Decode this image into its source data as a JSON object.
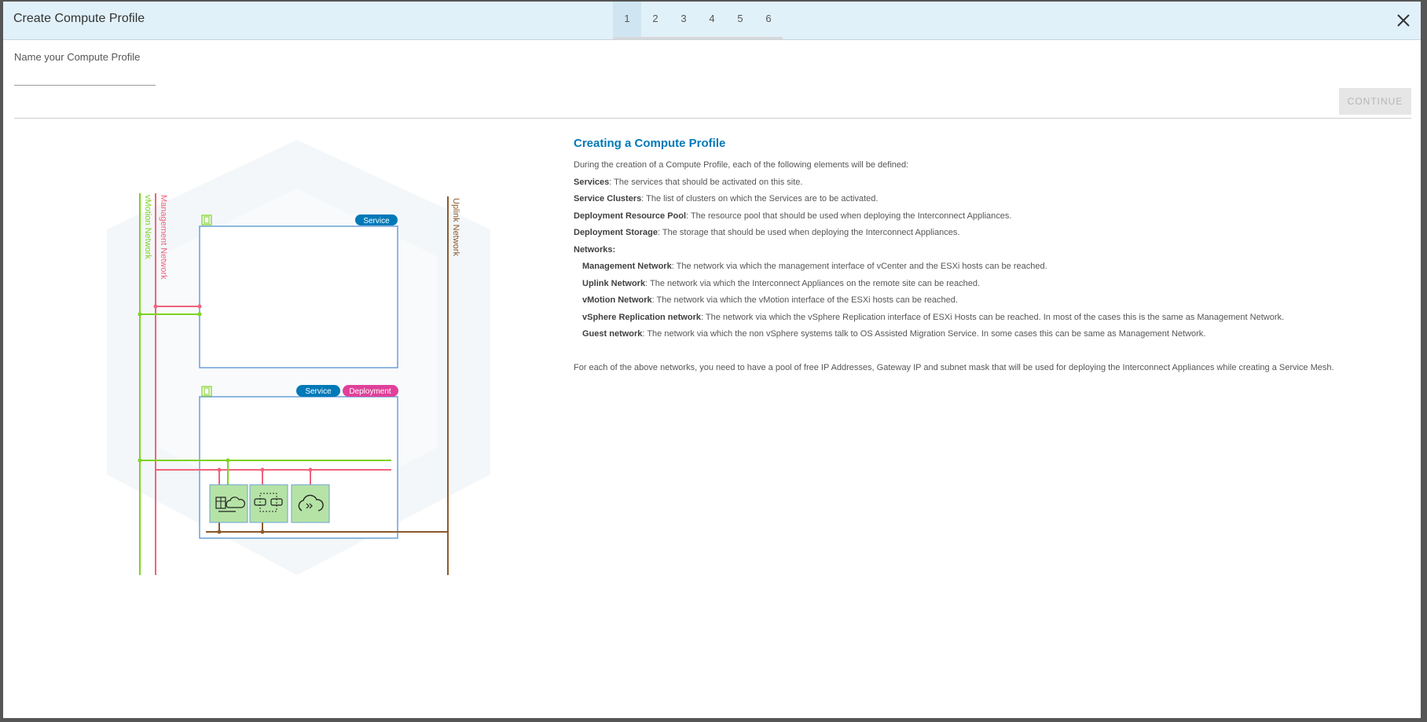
{
  "modal": {
    "title": "Create Compute Profile",
    "steps": [
      "1",
      "2",
      "3",
      "4",
      "5",
      "6"
    ],
    "active_step": "1"
  },
  "form": {
    "name_label": "Name your Compute Profile",
    "name_value": "",
    "continue_label": "CONTINUE"
  },
  "diagram": {
    "networks": {
      "vmotion": "vMotion Network",
      "management": "Management Network",
      "uplink": "Uplink Network"
    },
    "cluster1_badges": [
      "Service"
    ],
    "cluster2_badges": [
      "Service",
      "Deployment"
    ],
    "colors": {
      "vmotion": "#7ed321",
      "management": "#f0637c",
      "uplink": "#8b5a2b",
      "cluster_border": "#6aa0d8",
      "service_badge": "#0079b8",
      "deployment_badge": "#e0409a",
      "appliance_fill": "#b5e3a6"
    }
  },
  "description": {
    "heading": "Creating a Compute Profile",
    "intro": "During the creation of a Compute Profile, each of the following elements will be defined:",
    "items": [
      {
        "term": "Services",
        "text": ": The services that should be activated on this site."
      },
      {
        "term": "Service Clusters",
        "text": ": The list of clusters on which the Services are to be activated."
      },
      {
        "term": "Deployment Resource Pool",
        "text": ": The resource pool that should be used when deploying the Interconnect Appliances."
      },
      {
        "term": "Deployment Storage",
        "text": ": The storage that should be used when deploying the Interconnect Appliances."
      }
    ],
    "networks_heading": "Networks:",
    "networks": [
      {
        "term": "Management Network",
        "text": ": The network via which the management interface of vCenter and the ESXi hosts can be reached."
      },
      {
        "term": "Uplink Network",
        "text": ": The network via which the Interconnect Appliances on the remote site can be reached."
      },
      {
        "term": "vMotion Network",
        "text": ": The network via which the vMotion interface of the ESXi hosts can be reached."
      },
      {
        "term": "vSphere Replication network",
        "text": ": The network via which the vSphere Replication interface of ESXi Hosts can be reached. In most of the cases this is the same as Management Network."
      },
      {
        "term": "Guest network",
        "text": ": The network via which the non vSphere systems talk to OS Assisted Migration Service. In some cases this can be same as Management Network."
      }
    ],
    "footer": "For each of the above networks, you need to have a pool of free IP Addresses, Gateway IP and subnet mask that will be used for deploying the Interconnect Appliances while creating a Service Mesh."
  }
}
